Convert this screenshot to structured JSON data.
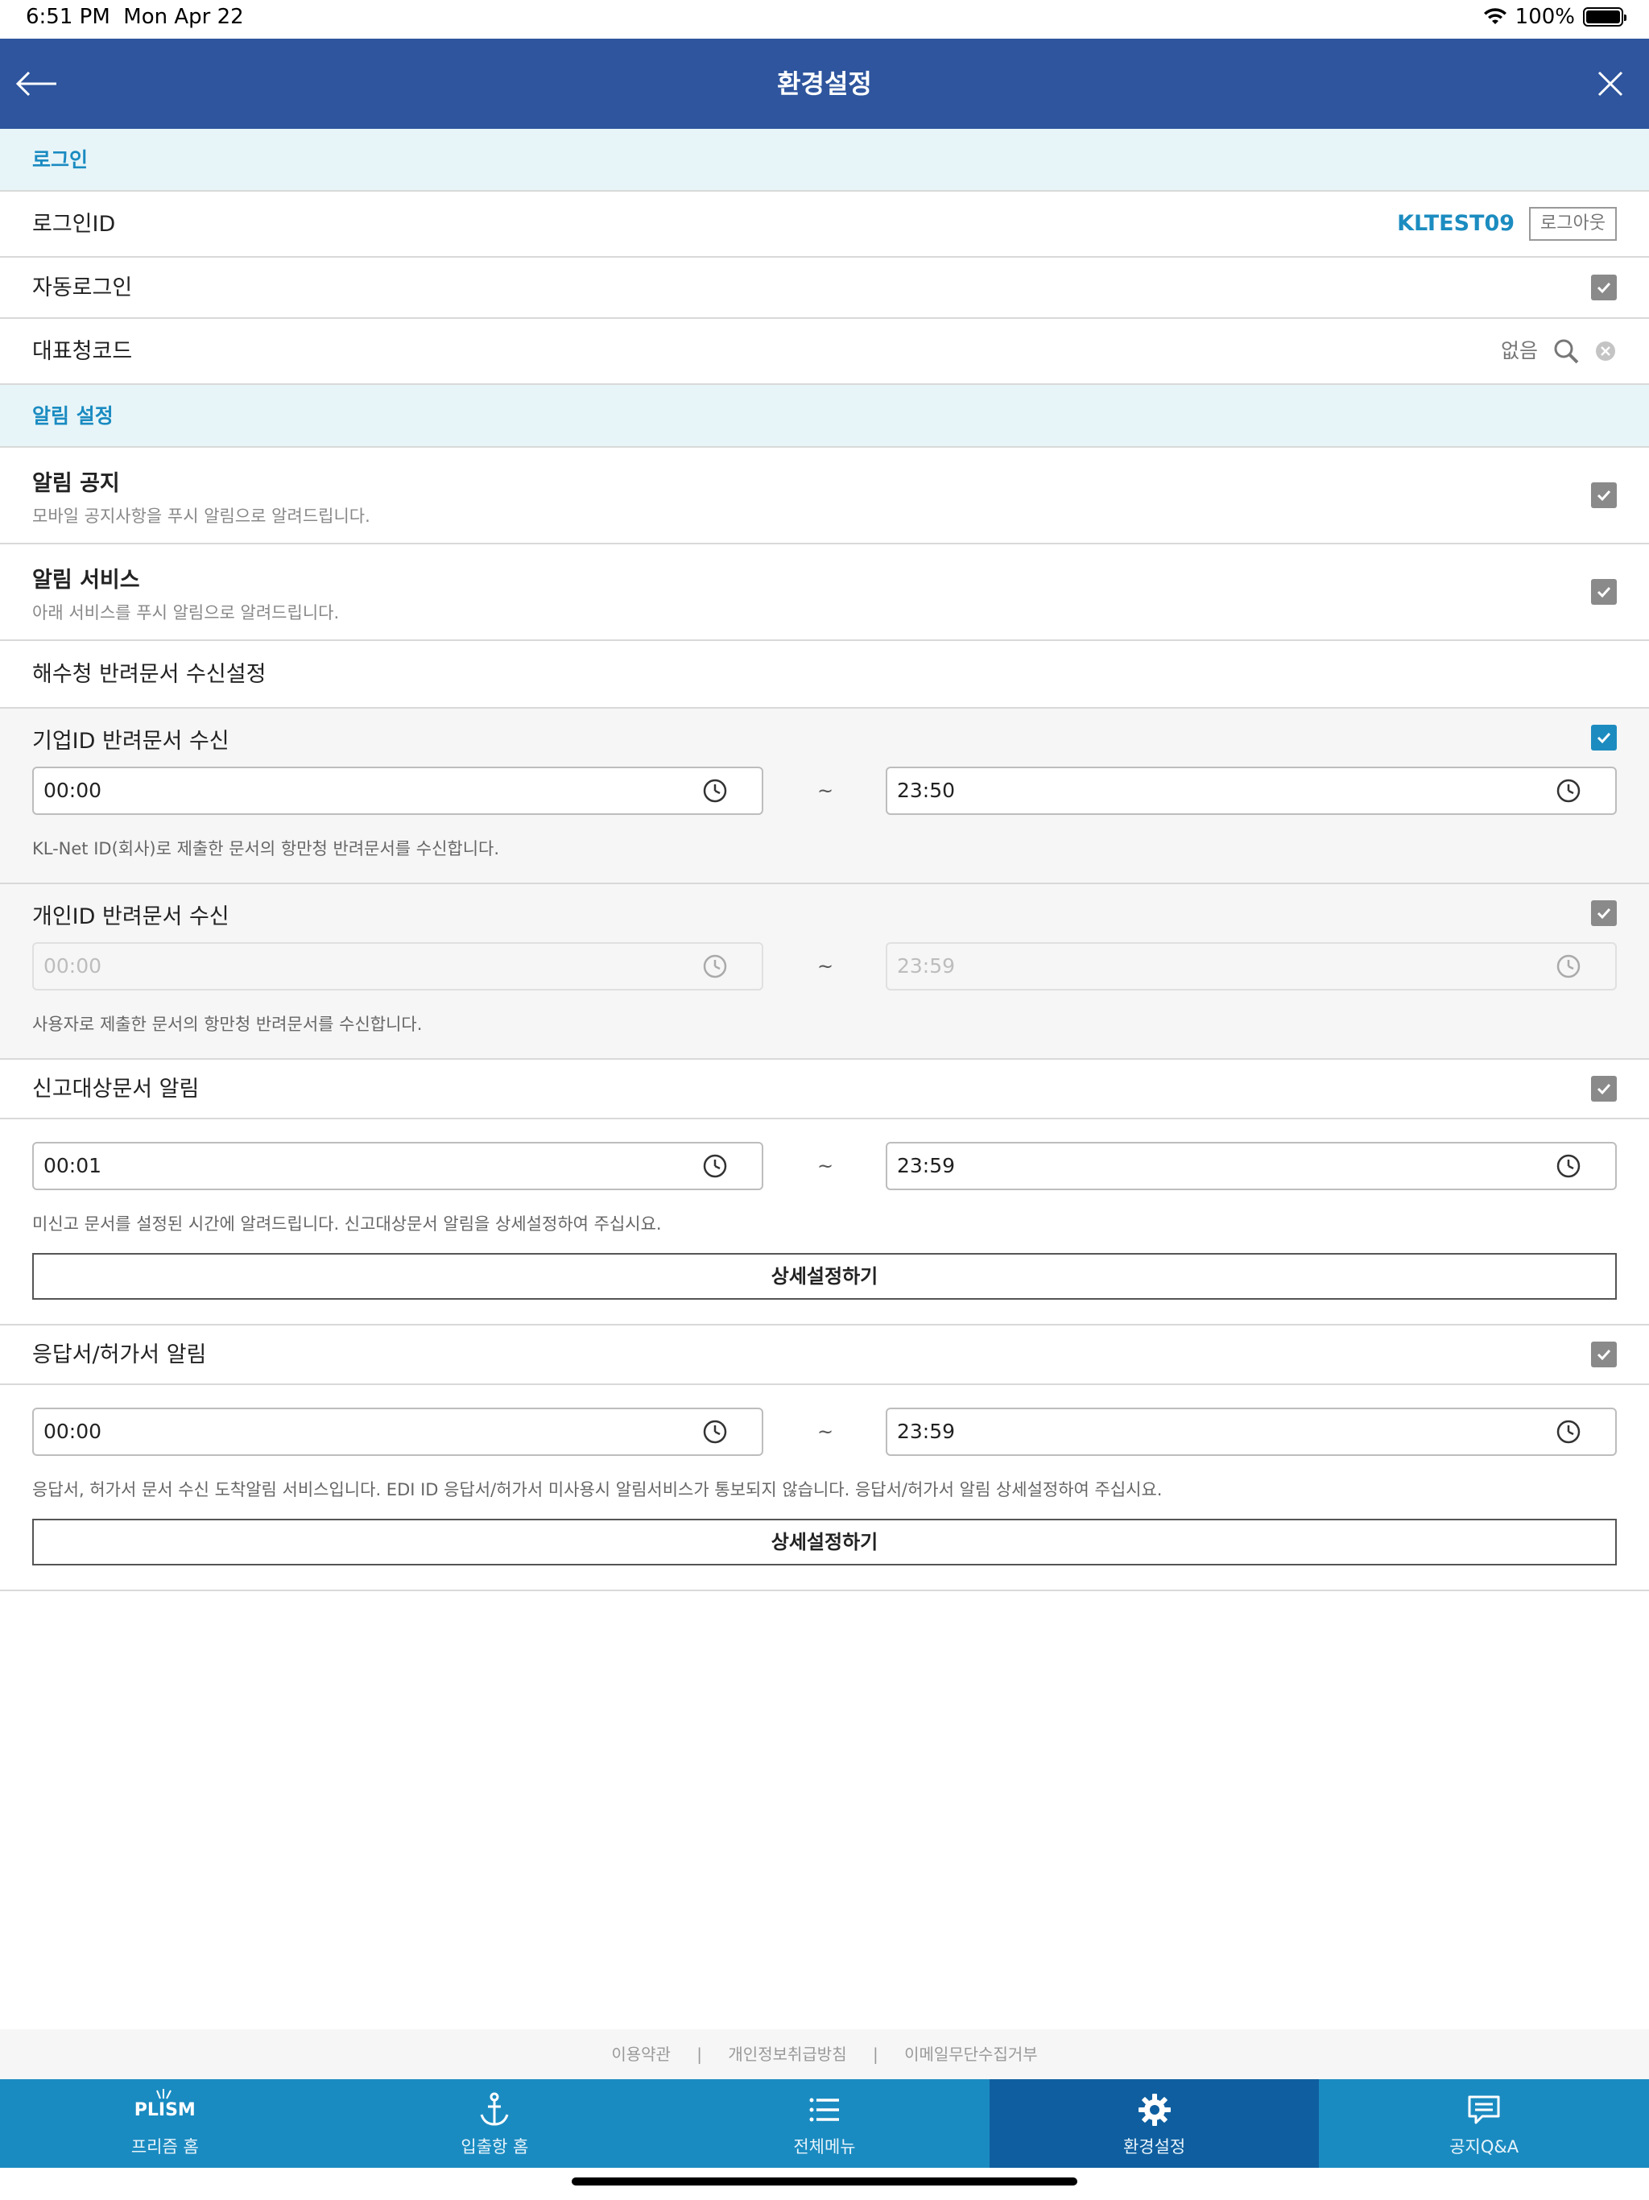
{
  "status_bar": {
    "time": "6:51 PM",
    "date": "Mon Apr 22",
    "battery": "100%",
    "wifi_icon": "wifi-icon"
  },
  "header": {
    "title": "환경설정",
    "back_icon": "arrow-left-icon",
    "close_icon": "close-icon"
  },
  "login_section": {
    "title": "로그인",
    "login_id_label": "로그인ID",
    "login_id_value": "KLTEST09",
    "logout_label": "로그아웃",
    "auto_login_label": "자동로그인",
    "auto_login_checked": true,
    "rep_code_label": "대표청코드",
    "rep_code_value": "없음"
  },
  "alarm_section": {
    "title": "알림 설정",
    "notice": {
      "title": "알림 공지",
      "desc": "모바일 공지사항을 푸시 알림으로 알려드립니다.",
      "checked": true
    },
    "service": {
      "title": "알림 서비스",
      "desc": "아래 서비스를 푸시 알림으로 알려드립니다.",
      "checked": true
    },
    "return_doc_title": "해수청 반려문서 수신설정",
    "corp_return": {
      "title": "기업ID 반려문서 수신",
      "checked": true,
      "start": "00:00",
      "end": "23:50",
      "sep": "~",
      "help": "KL-Net ID(회사)로 제출한 문서의 항만청 반려문서를 수신합니다."
    },
    "personal_return": {
      "title": "개인ID 반려문서 수신",
      "checked": true,
      "start": "00:00",
      "end": "23:59",
      "sep": "~",
      "help": "사용자로 제출한 문서의 항만청 반려문서를 수신합니다."
    },
    "report_target": {
      "title": "신고대상문서 알림",
      "checked": true,
      "start": "00:01",
      "end": "23:59",
      "sep": "~",
      "help": "미신고 문서를 설정된 시간에 알려드립니다. 신고대상문서 알림을 상세설정하여 주십시요.",
      "button": "상세설정하기"
    },
    "response": {
      "title": "응답서/허가서 알림",
      "checked": true,
      "start": "00:00",
      "end": "23:59",
      "sep": "~",
      "help": "응답서, 허가서 문서 수신 도착알림 서비스입니다. EDI ID 응답서/허가서 미사용시 알림서비스가 통보되지 않습니다. 응답서/허가서 알림 상세설정하여 주십시요.",
      "button": "상세설정하기"
    }
  },
  "footer": {
    "links": [
      "이용약관",
      "개인정보취급방침",
      "이메일무단수집거부"
    ],
    "separator": "|"
  },
  "tabs": [
    {
      "label": "프리즘 홈",
      "logo": "PLISM",
      "icon": "plism-logo-icon"
    },
    {
      "label": "입출항 홈",
      "icon": "anchor-icon"
    },
    {
      "label": "전체메뉴",
      "icon": "menu-icon"
    },
    {
      "label": "환경설정",
      "icon": "gear-icon",
      "active": true
    },
    {
      "label": "공지Q&A",
      "icon": "chat-icon"
    }
  ],
  "colors": {
    "header": "#2e559d",
    "accent": "#1a8bc1",
    "tab_active": "#0f5fa0"
  }
}
